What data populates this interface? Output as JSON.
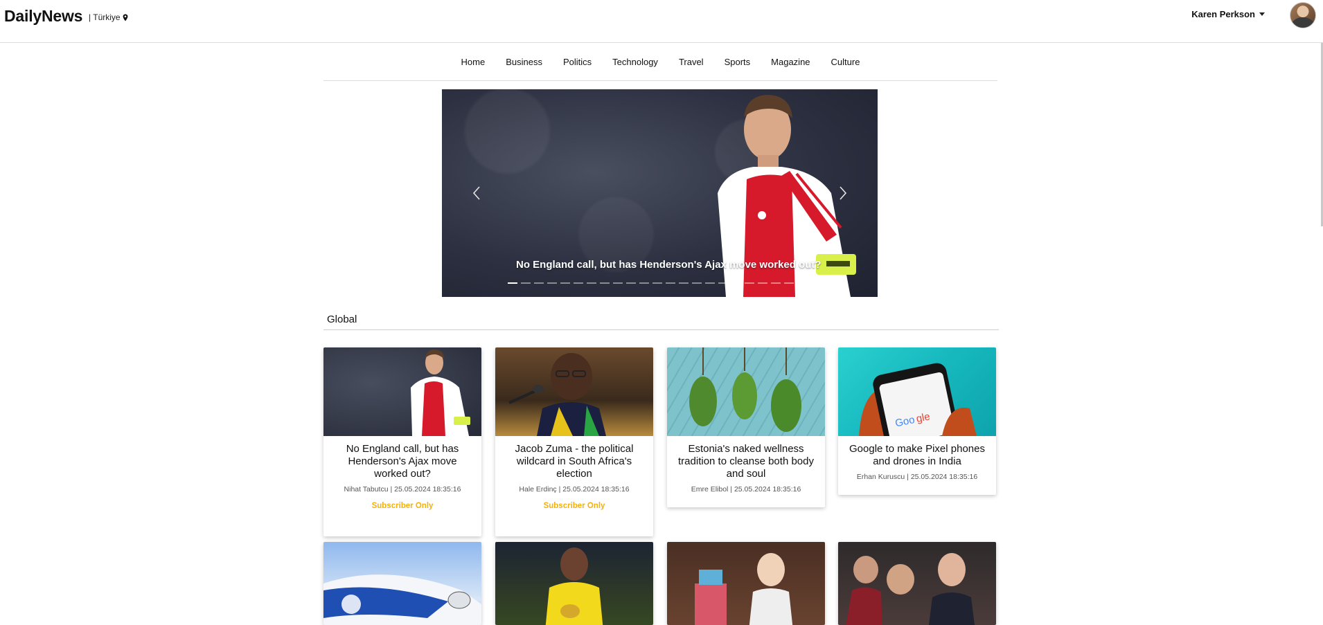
{
  "header": {
    "brand": "DailyNews",
    "locale": "| Türkiye",
    "user_name": "Karen Perkson"
  },
  "nav": {
    "items": [
      "Home",
      "Business",
      "Politics",
      "Technology",
      "Travel",
      "Sports",
      "Magazine",
      "Culture"
    ]
  },
  "hero": {
    "title": "No England call, but has Henderson's Ajax move worked out?",
    "slide_count": 22,
    "active_slide": 1
  },
  "section": {
    "title": "Global"
  },
  "articles": [
    {
      "title": "No England call, but has Henderson's Ajax move worked out?",
      "meta": "Nihat Tabutcu | 25.05.2024 18:35:16",
      "badge": "Subscriber Only"
    },
    {
      "title": "Jacob Zuma - the political wildcard in South Africa's election",
      "meta": "Hale Erdinç | 25.05.2024 18:35:16",
      "badge": "Subscriber Only"
    },
    {
      "title": "Estonia's naked wellness tradition to cleanse both body and soul",
      "meta": "Emre Elibol | 25.05.2024 18:35:16",
      "badge": ""
    },
    {
      "title": "Google to make Pixel phones and drones in India",
      "meta": "Erhan Kuruscu | 25.05.2024 18:35:16",
      "badge": ""
    }
  ],
  "colors": {
    "subscriber_badge": "#f2b10b",
    "divider": "#dcdcdc"
  }
}
